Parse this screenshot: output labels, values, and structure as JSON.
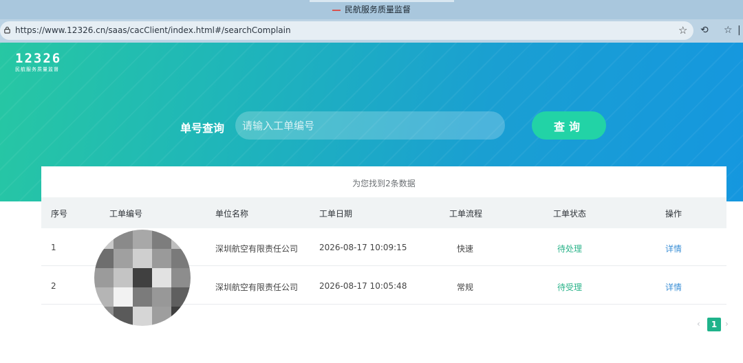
{
  "browser": {
    "window_title": "民航服务质量监督",
    "url": "https://www.12326.cn/saas/cacClient/index.html#/searchComplain"
  },
  "header": {
    "logo_number": "12326",
    "logo_subtitle": "民航服务质量监督"
  },
  "search": {
    "label": "单号查询",
    "placeholder": "请输入工单编号",
    "value": "",
    "button_label": "查询"
  },
  "results": {
    "summary": "为您找到2条数据",
    "columns": [
      "序号",
      "工单编号",
      "单位名称",
      "工单日期",
      "工单流程",
      "工单状态",
      "操作"
    ],
    "rows": [
      {
        "index": "1",
        "unit": "深圳航空有限责任公司",
        "date": "2026-08-17 10:09:15",
        "process": "快速",
        "status": "待处理",
        "action": "详情"
      },
      {
        "index": "2",
        "unit": "深圳航空有限责任公司",
        "date": "2026-08-17 10:05:48",
        "process": "常规",
        "status": "待受理",
        "action": "详情"
      }
    ]
  },
  "pagination": {
    "prev": "‹",
    "current_page": "1",
    "next": "›"
  },
  "colors": {
    "accent": "#22d3a6",
    "status": "#2bb38a",
    "link": "#3b8fd6"
  }
}
